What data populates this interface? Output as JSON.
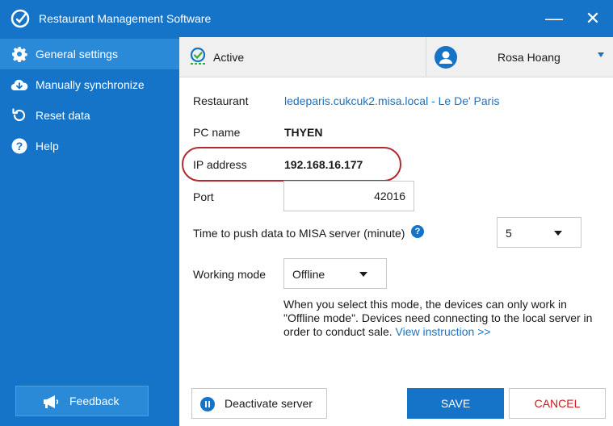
{
  "window": {
    "title": "Restaurant Management Software",
    "minimize": "—",
    "close": "✕"
  },
  "sidebar": {
    "items": [
      {
        "label": "General settings",
        "icon": "gear-icon",
        "active": true
      },
      {
        "label": "Manually synchronize",
        "icon": "cloud-download-icon",
        "active": false
      },
      {
        "label": "Reset data",
        "icon": "reset-icon",
        "active": false
      },
      {
        "label": "Help",
        "icon": "help-icon",
        "active": false
      }
    ],
    "feedback_label": "Feedback"
  },
  "status": {
    "label": "Active",
    "icon": "server-active-icon"
  },
  "user": {
    "name": "Rosa Hoang"
  },
  "form": {
    "restaurant_label": "Restaurant",
    "restaurant_value": "ledeparis.cukcuk2.misa.local - Le De' Paris",
    "pc_name_label": "PC name",
    "pc_name_value": "THYEN",
    "ip_label": "IP address",
    "ip_value": "192.168.16.177",
    "port_label": "Port",
    "port_value": "42016",
    "push_time_label": "Time to push data to MISA server (minute)",
    "push_time_value": "5",
    "working_mode_label": "Working mode",
    "working_mode_value": "Offline",
    "description": "When you select this mode, the devices can only work in \"Offline mode\". Devices need connecting to the local server in order to conduct sale.",
    "view_instruction": "View instruction >>"
  },
  "buttons": {
    "deactivate": "Deactivate server",
    "save": "SAVE",
    "cancel": "CANCEL"
  },
  "colors": {
    "primary": "#1574c7",
    "sidebar_active": "#2a8ad8",
    "link": "#1a73c6",
    "cancel_text": "#d01818",
    "highlight": "#b02a30",
    "status_green": "#3aaa35"
  }
}
